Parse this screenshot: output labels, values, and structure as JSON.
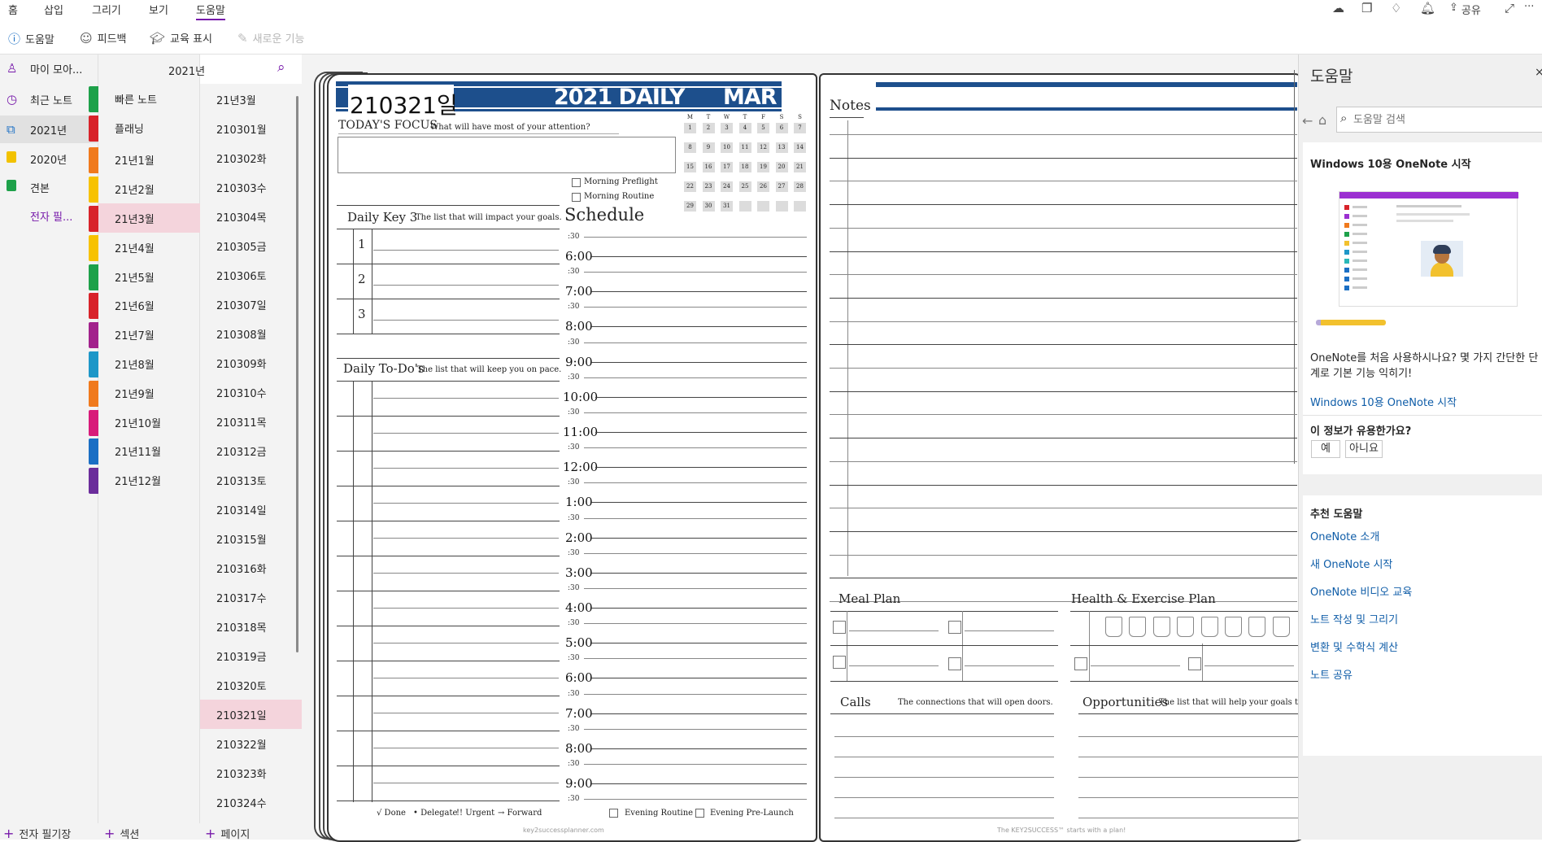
{
  "ribbon": {
    "tabs": [
      "홈",
      "삽입",
      "그리기",
      "보기",
      "도움말"
    ],
    "active_tab": "도움말",
    "commands": {
      "help": "도움말",
      "feedback": "피드백",
      "training": "교육 표시",
      "whats_new": "새로운 기능"
    },
    "right": {
      "share": "공유",
      "more": "···"
    },
    "accent": "#7719aa"
  },
  "notebooks": {
    "account": "마이 모아...",
    "items": [
      {
        "label": "최근 노트",
        "icon": "clock-icon"
      },
      {
        "label": "2021년",
        "icon": "notebook-icon",
        "color": "#1b6fc4"
      },
      {
        "label": "2020년",
        "icon": "notebook-icon",
        "color": "#f2c200"
      },
      {
        "label": "견본",
        "icon": "notebook-icon",
        "color": "#1ea14a"
      },
      {
        "label": "전자 필...",
        "icon": "",
        "color": "#7719aa"
      }
    ],
    "add_label": "전자 필기장"
  },
  "sections": {
    "header": "2021년",
    "items": [
      {
        "label": "빠른 노트",
        "color": "#1ea14a"
      },
      {
        "label": "플래닝",
        "color": "#d8232a"
      },
      {
        "label": "21년1월",
        "color": "#f07a1d"
      },
      {
        "label": "21년2월",
        "color": "#f7c200"
      },
      {
        "label": "21년3월",
        "color": "#d8232a"
      },
      {
        "label": "21년4월",
        "color": "#f7c200"
      },
      {
        "label": "21년5월",
        "color": "#1ea14a"
      },
      {
        "label": "21년6월",
        "color": "#d8232a"
      },
      {
        "label": "21년7월",
        "color": "#a2228c"
      },
      {
        "label": "21년8월",
        "color": "#1e97c8"
      },
      {
        "label": "21년9월",
        "color": "#f07a1d"
      },
      {
        "label": "21년10월",
        "color": "#d81b7a"
      },
      {
        "label": "21년11월",
        "color": "#1b6fc4"
      },
      {
        "label": "21년12월",
        "color": "#6b2d9b"
      }
    ],
    "selected": "21년3월",
    "add_label": "섹션"
  },
  "pages": {
    "items": [
      "21년3월",
      "210301월",
      "210302화",
      "210303수",
      "210304목",
      "210305금",
      "210306토",
      "210307일",
      "210308월",
      "210309화",
      "210310수",
      "210311목",
      "210312금",
      "210313토",
      "210314일",
      "210315월",
      "210316화",
      "210317수",
      "210318목",
      "210319금",
      "210320토",
      "210321일",
      "210322월",
      "210323화",
      "210324수"
    ],
    "selected": "210321일",
    "add_label": "페이지"
  },
  "planner": {
    "page_title": "210321일",
    "banner": "2021 DAILY",
    "month": "MAR",
    "focus_title": "TODAY'S FOCUS",
    "focus_sub": "What will have most of your attention?",
    "morning": [
      "Morning Preflight",
      "Morning Routine"
    ],
    "cal_heads": [
      "M",
      "T",
      "W",
      "T",
      "F",
      "S",
      "S"
    ],
    "cal_days": [
      "1",
      "2",
      "3",
      "4",
      "5",
      "6",
      "7",
      "8",
      "9",
      "10",
      "11",
      "12",
      "13",
      "14",
      "15",
      "16",
      "17",
      "18",
      "19",
      "20",
      "21",
      "22",
      "23",
      "24",
      "25",
      "26",
      "27",
      "28",
      "29",
      "30",
      "31"
    ],
    "key3_title": "Daily Key 3",
    "key3_sub": "The list that will impact your goals.",
    "key3_nums": [
      "1",
      "2",
      "3"
    ],
    "schedule_title": "Schedule",
    "times": [
      "6:00",
      "7:00",
      "8:00",
      "9:00",
      "10:00",
      "11:00",
      "12:00",
      "1:00",
      "2:00",
      "3:00",
      "4:00",
      "5:00",
      "6:00",
      "7:00",
      "8:00",
      "9:00"
    ],
    "half": ":30",
    "todo_title": "Daily To-Do's",
    "todo_sub": "The list that will keep you on pace.",
    "legend": [
      "√ Done",
      "• Delegate",
      "!! Urgent",
      "→ Forward"
    ],
    "evening": [
      "Evening Routine",
      "Evening Pre-Launch"
    ],
    "footer_left": "key2successplanner.com",
    "notes_title": "Notes",
    "meal_title": "Meal Plan",
    "health_title": "Health & Exercise Plan",
    "calls_title": "Calls",
    "calls_sub": "The connections that will open doors.",
    "opp_title": "Opportunities",
    "opp_sub": "The list that will help your goals take-o",
    "footer_right": "The KEY2SUCCESS™ starts with a plan!",
    "brand_blue": "#1d4f8c"
  },
  "help": {
    "title": "도움말",
    "search_placeholder": "도움말 검색",
    "card_title": "Windows 10용 OneNote 시작",
    "intro": "OneNote를 처음 사용하시나요? 몇 가지 간단한 단계로 기본 기능 익히기!",
    "intro_link": "Windows 10용 OneNote 시작",
    "useful_q": "이 정보가 유용한가요?",
    "yes": "예",
    "no": "아니요",
    "recommended_title": "추천 도움말",
    "recommended": [
      "OneNote 소개",
      "새 OneNote 시작",
      "OneNote 비디오 교육",
      "노트 작성 및 그리기",
      "변환 및 수학식 계산",
      "노트 공유"
    ]
  }
}
